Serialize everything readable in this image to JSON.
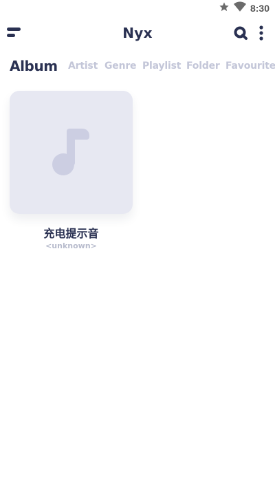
{
  "status_bar": {
    "time": "8:30",
    "icons": [
      "star-icon",
      "wifi-icon"
    ]
  },
  "app_bar": {
    "title": "Nyx",
    "left_icon": "menu-icon",
    "right_icons": [
      "search-icon",
      "more-vert-icon"
    ]
  },
  "tabs": [
    {
      "label": "Album",
      "active": true
    },
    {
      "label": "Artist",
      "active": false
    },
    {
      "label": "Genre",
      "active": false
    },
    {
      "label": "Playlist",
      "active": false
    },
    {
      "label": "Folder",
      "active": false
    },
    {
      "label": "Favourite",
      "active": false
    }
  ],
  "albums": [
    {
      "title": "充电提示音",
      "artist": "<unknown>",
      "art_icon": "music-note-icon"
    }
  ],
  "colors": {
    "primary_text": "#2a3152",
    "inactive_tab": "#c3c6d8",
    "art_background": "#e7e8f2",
    "art_icon": "#ccceE2"
  }
}
